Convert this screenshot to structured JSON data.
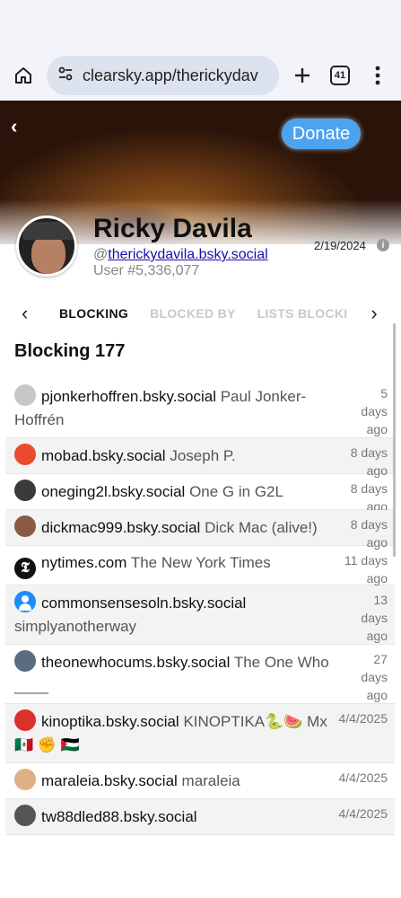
{
  "browser": {
    "url": "clearsky.app/therickydav",
    "tab_count": "41"
  },
  "banner": {
    "back_label": "‹",
    "donate_label": "Donate"
  },
  "profile": {
    "name": "Ricky Davila",
    "handle_prefix": "@",
    "handle": "therickydavila.bsky.social",
    "user_number": "User #5,336,077",
    "date": "2/19/2024",
    "info_label": "i"
  },
  "tabs": {
    "prev_label": "‹",
    "next_label": "›",
    "items": [
      "BLOCKING",
      "BLOCKED BY",
      "LISTS BLOCKIN"
    ]
  },
  "list": {
    "title": "Blocking 177",
    "rows": [
      {
        "handle": "pjonkerhoffren.bsky.social",
        "display_name": "Paul Jonker-Hoffrén",
        "time": "5 days ago",
        "avatar": "gray"
      },
      {
        "handle": "mobad.bsky.social",
        "display_name": "Joseph P.",
        "time": "8 days ago",
        "avatar": "orange"
      },
      {
        "handle": "oneging2l.bsky.social",
        "display_name": "One G in G2L",
        "time": "8 days ago",
        "avatar": "dark"
      },
      {
        "handle": "dickmac999.bsky.social",
        "display_name": "Dick Mac (alive!)",
        "time": "8 days ago",
        "avatar": "brown"
      },
      {
        "handle": "nytimes.com",
        "display_name": "The New York Times",
        "time": "11 days ago",
        "avatar": "black"
      },
      {
        "handle": "commonsensesoln.bsky.social",
        "display_name": "simplyanotherway",
        "time": "13 days ago",
        "avatar": "blue"
      },
      {
        "handle": "theonewhocums.bsky.social",
        "display_name": "The One Who ____",
        "time": "27 days ago",
        "avatar": "steel"
      },
      {
        "handle": "kinoptika.bsky.social",
        "display_name": "KINOPTIKA🐍🍉 Mx 🇲🇽 ✊ 🇵🇸",
        "time": "4/4/2025",
        "avatar": "red"
      },
      {
        "handle": "maraleia.bsky.social",
        "display_name": "maraleia",
        "time": "4/4/2025",
        "avatar": "tan"
      },
      {
        "handle": "tw88dled88.bsky.social",
        "display_name": "",
        "time": "4/4/2025",
        "avatar": "slate"
      }
    ]
  },
  "icons": {
    "home": "home-icon",
    "site_settings": "tune-icon",
    "new_tab": "plus-icon",
    "tabs": "tab-switcher-icon",
    "menu": "more-vert-icon"
  }
}
